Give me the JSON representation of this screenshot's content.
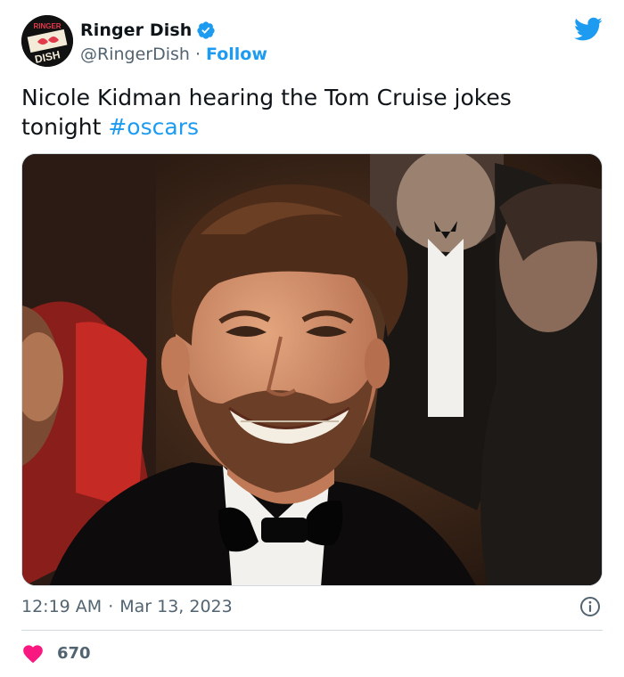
{
  "account": {
    "display_name": "Ringer Dish",
    "handle": "@RingerDish",
    "separator": "·",
    "follow_label": "Follow",
    "avatar_text_top": "RINGER",
    "avatar_text_bottom": "DISH"
  },
  "tweet": {
    "text": "Nicole Kidman hearing the Tom Cruise jokes tonight ",
    "hashtag": "#oscars",
    "time": "12:19 AM",
    "meta_separator": "·",
    "date": "Mar 13, 2023",
    "like_count": "670"
  },
  "icons": {
    "verified": "verified-badge-icon",
    "logo": "twitter-bird-icon",
    "info": "info-icon",
    "like": "heart-icon"
  },
  "colors": {
    "accent": "#1d9bf0",
    "like": "#f91880",
    "secondary_text": "#536471",
    "primary_text": "#0f1419"
  }
}
